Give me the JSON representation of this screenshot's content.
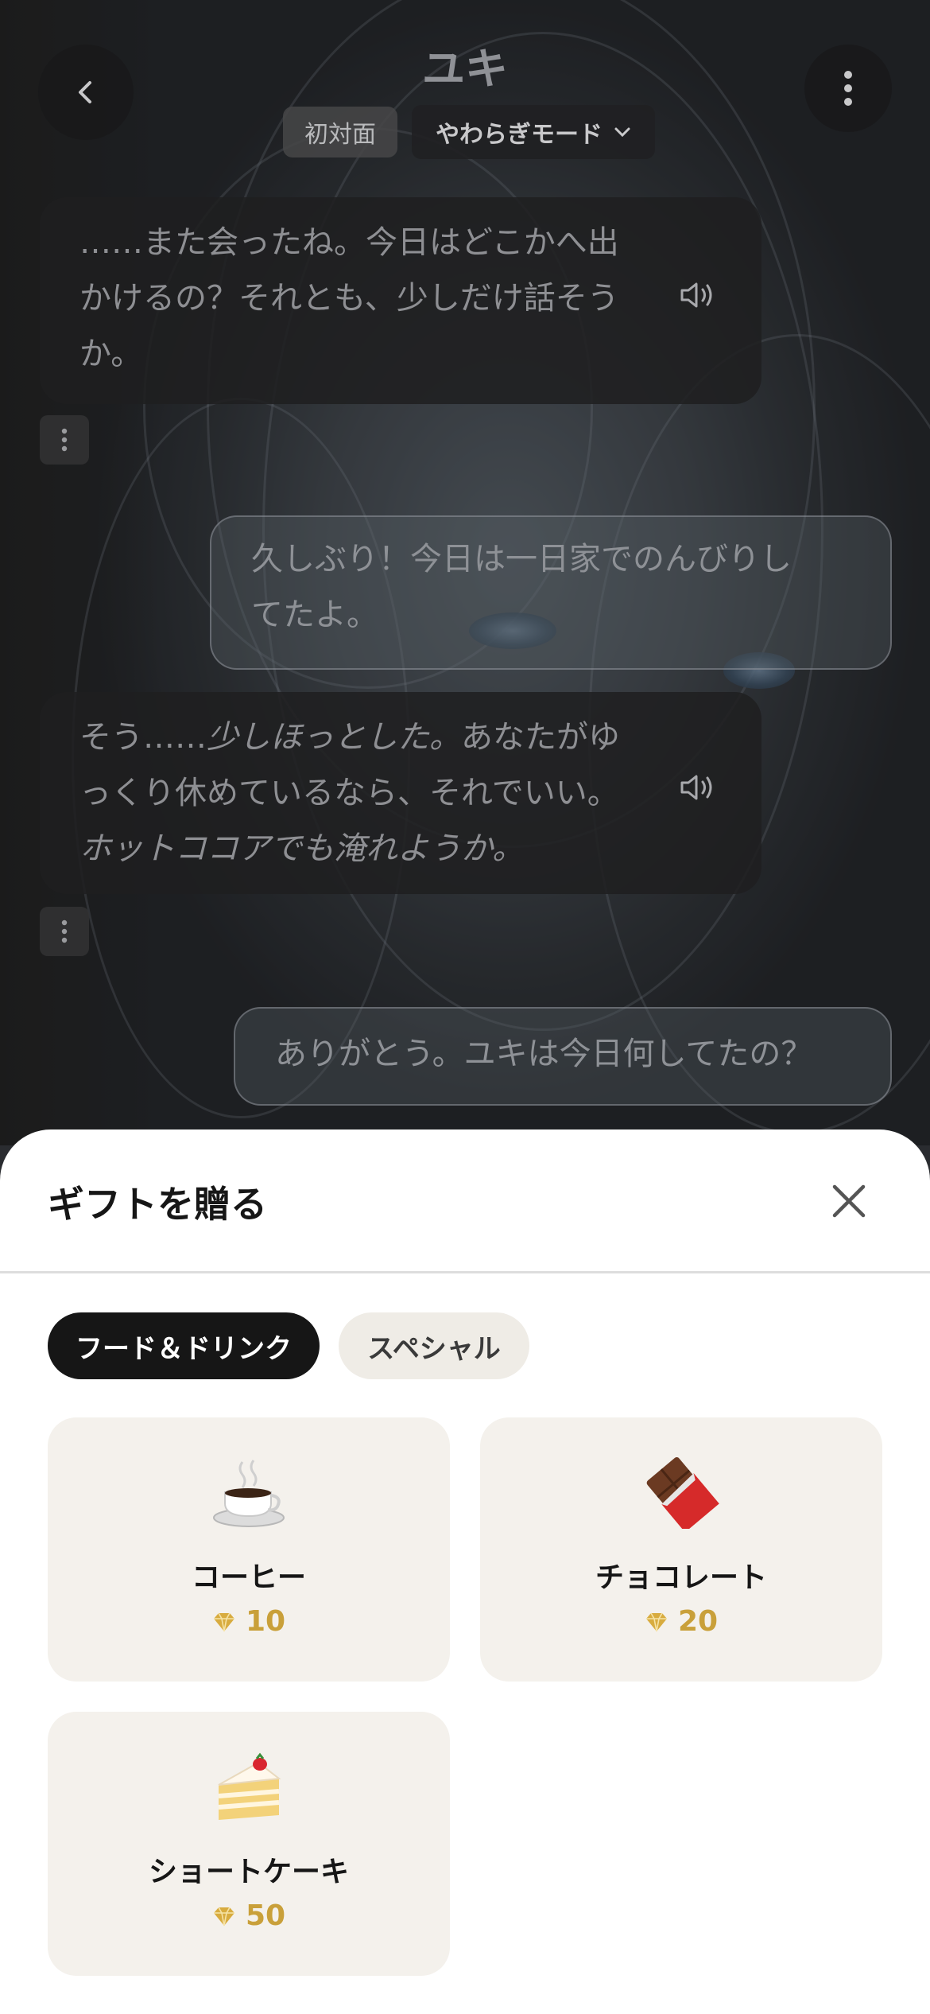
{
  "header": {
    "title": "ユキ",
    "relationship_chip": "初対面",
    "mode_chip": "やわらぎモード"
  },
  "messages": [
    {
      "role": "ai",
      "lines": [
        "……また会ったね。今日はどこかへ出",
        "かけるの？それとも、少しだけ話そう",
        "か。"
      ]
    },
    {
      "role": "user",
      "lines": [
        "久しぶり！今日は一日家でのんびりし",
        "てたよ。"
      ]
    },
    {
      "role": "ai",
      "line1_plain": "そう……",
      "line1_italic": "少しほっとした。",
      "line1_rest": "あなたがゆ",
      "line2": "っくり休めているなら、それでいい。",
      "line3_italic": "ホットココアでも淹れようか。"
    },
    {
      "role": "user",
      "lines": [
        "ありがとう。ユキは今日何してたの？"
      ]
    }
  ],
  "gift_sheet": {
    "title": "ギフトを贈る",
    "tabs": [
      "フード＆ドリンク",
      "スペシャル"
    ],
    "active_tab": "フード＆ドリンク",
    "items": [
      {
        "name": "コーヒー",
        "price": "10",
        "icon": "coffee-icon"
      },
      {
        "name": "チョコレート",
        "price": "20",
        "icon": "chocolate-icon"
      },
      {
        "name": "ショートケーキ",
        "price": "50",
        "icon": "shortcake-icon"
      }
    ]
  },
  "colors": {
    "gem_gold": "#c9a03a",
    "active_tab_bg": "#161616",
    "card_bg": "#f4f1ec"
  }
}
